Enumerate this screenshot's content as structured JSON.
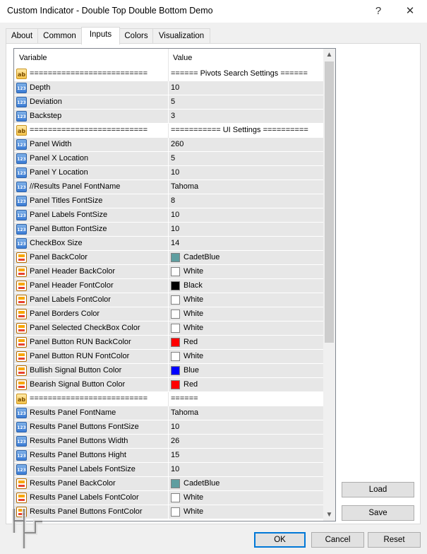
{
  "window": {
    "title": "Custom Indicator - Double Top Double Bottom Demo",
    "help_glyph": "?",
    "close_glyph": "✕"
  },
  "tabs": [
    {
      "label": "About"
    },
    {
      "label": "Common"
    },
    {
      "label": "Inputs",
      "active": true
    },
    {
      "label": "Colors"
    },
    {
      "label": "Visualization"
    }
  ],
  "grid": {
    "col_variable": "Variable",
    "col_value": "Value",
    "rows": [
      {
        "icon": "ab",
        "variable": "==========================",
        "value": "====== Pivots Search Settings ======"
      },
      {
        "icon": "123",
        "variable": "Depth",
        "value": "10"
      },
      {
        "icon": "123",
        "variable": "Deviation",
        "value": "5"
      },
      {
        "icon": "123",
        "variable": "Backstep",
        "value": "3"
      },
      {
        "icon": "ab",
        "variable": "==========================",
        "value": "=========== UI Settings =========="
      },
      {
        "icon": "123",
        "variable": "Panel Width",
        "value": "260"
      },
      {
        "icon": "123",
        "variable": "Panel X Location",
        "value": "5"
      },
      {
        "icon": "123",
        "variable": "Panel Y Location",
        "value": "10"
      },
      {
        "icon": "123",
        "variable": "//Results Panel FontName",
        "value": "Tahoma"
      },
      {
        "icon": "123",
        "variable": "Panel Titles FontSize",
        "value": "8"
      },
      {
        "icon": "123",
        "variable": "Panel Labels FontSize",
        "value": "10"
      },
      {
        "icon": "123",
        "variable": "Panel Button FontSize",
        "value": "10"
      },
      {
        "icon": "123",
        "variable": "CheckBox Size",
        "value": "14"
      },
      {
        "icon": "color",
        "variable": "Panel BackColor",
        "value": "CadetBlue",
        "swatch": "#5f9ea0"
      },
      {
        "icon": "color",
        "variable": "Panel Header BackColor",
        "value": "White",
        "swatch": "#ffffff"
      },
      {
        "icon": "color",
        "variable": "Panel Header FontColor",
        "value": "Black",
        "swatch": "#000000"
      },
      {
        "icon": "color",
        "variable": "Panel Labels FontColor",
        "value": "White",
        "swatch": "#ffffff"
      },
      {
        "icon": "color",
        "variable": "Panel Borders Color",
        "value": "White",
        "swatch": "#ffffff"
      },
      {
        "icon": "color",
        "variable": "Panel Selected CheckBox Color",
        "value": "White",
        "swatch": "#ffffff"
      },
      {
        "icon": "color",
        "variable": "Panel Button RUN BackColor",
        "value": "Red",
        "swatch": "#ff0000"
      },
      {
        "icon": "color",
        "variable": "Panel Button RUN FontColor",
        "value": "White",
        "swatch": "#ffffff"
      },
      {
        "icon": "color",
        "variable": "Bullish Signal Button Color",
        "value": "Blue",
        "swatch": "#0000ff"
      },
      {
        "icon": "color",
        "variable": "Bearish Signal Button Color",
        "value": "Red",
        "swatch": "#ff0000"
      },
      {
        "icon": "ab",
        "variable": "==========================",
        "value": "======"
      },
      {
        "icon": "123",
        "variable": "Results Panel FontName",
        "value": "Tahoma"
      },
      {
        "icon": "123",
        "variable": "Results Panel Buttons FontSize",
        "value": "10"
      },
      {
        "icon": "123",
        "variable": "Results Panel Buttons Width",
        "value": "26"
      },
      {
        "icon": "123",
        "variable": "Results Panel Buttons Hight",
        "value": "15"
      },
      {
        "icon": "123",
        "variable": "Results Panel Labels FontSize",
        "value": "10"
      },
      {
        "icon": "color",
        "variable": "Results Panel BackColor",
        "value": "CadetBlue",
        "swatch": "#5f9ea0"
      },
      {
        "icon": "color",
        "variable": "Results Panel Labels FontColor",
        "value": "White",
        "swatch": "#ffffff"
      },
      {
        "icon": "color",
        "variable": "Results Panel Buttons FontColor",
        "value": "White",
        "swatch": "#ffffff"
      }
    ]
  },
  "side_buttons": {
    "load": "Load",
    "save": "Save"
  },
  "footer_buttons": {
    "ok": "OK",
    "cancel": "Cancel",
    "reset": "Reset"
  },
  "colors": {
    "grid_border": "#828790",
    "default_button_border": "#0078d7",
    "alt_row": "#e7e7e7"
  }
}
